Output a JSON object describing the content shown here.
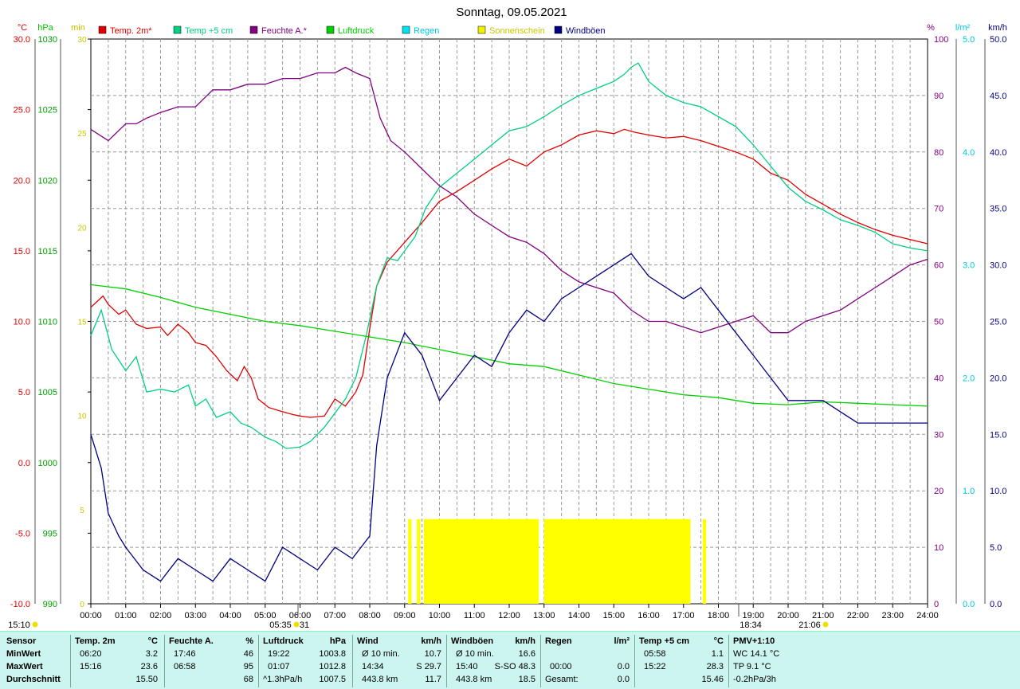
{
  "title": "Sonntag, 09.05.2021",
  "axes_left": {
    "temp_unit": "°C",
    "press_unit": "hPa",
    "min_unit": "min",
    "temp_ticks": [
      "30.0",
      "25.0",
      "20.0",
      "15.0",
      "10.0",
      "5.0",
      "0.0",
      "-5.0",
      "-10.0"
    ],
    "press_ticks": [
      "1030",
      "1025",
      "1020",
      "1015",
      "1010",
      "1005",
      "1000",
      "995",
      "990"
    ],
    "min_ticks": [
      "30",
      "25",
      "20",
      "15",
      "10",
      "5",
      "0"
    ]
  },
  "axes_right": {
    "pct_unit": "%",
    "rain_unit": "l/m²",
    "wind_unit": "km/h",
    "pct_ticks": [
      "100",
      "90",
      "80",
      "70",
      "60",
      "50",
      "40",
      "30",
      "20",
      "10",
      "0"
    ],
    "rain_ticks": [
      "5.0",
      "4.0",
      "3.0",
      "2.0",
      "1.0",
      "0.0"
    ],
    "wind_ticks": [
      "50.0",
      "45.0",
      "40.0",
      "35.0",
      "30.0",
      "25.0",
      "20.0",
      "15.0",
      "10.0",
      "5.0",
      "0.0"
    ]
  },
  "x_ticks": [
    "00:00",
    "01:00",
    "02:00",
    "03:00",
    "04:00",
    "05:00",
    "06:00",
    "07:00",
    "08:00",
    "09:00",
    "10:00",
    "11:00",
    "12:00",
    "13:00",
    "14:00",
    "15:00",
    "16:00",
    "17:00",
    "18:00",
    "19:00",
    "20:00",
    "21:00",
    "22:00",
    "23:00",
    "24:00"
  ],
  "markers": {
    "sunrise": "05:35",
    "sunrise_b": "31",
    "sunset": "18:34",
    "moonset": "21:06",
    "left_time": "15:10"
  },
  "legend": [
    {
      "label": "Temp. 2m*",
      "color": "#e00000"
    },
    {
      "label": "Temp +5 cm",
      "color": "#00d080"
    },
    {
      "label": "Feuchte A.*",
      "color": "#800080"
    },
    {
      "label": "Luftdruck",
      "color": "#00d000"
    },
    {
      "label": "Regen",
      "color": "#00e0f0"
    },
    {
      "label": "Sonnenschein",
      "color": "#f0f000"
    },
    {
      "label": "Windböen",
      "color": "#000080"
    }
  ],
  "chart_data": {
    "type": "line",
    "title": "Sonntag, 09.05.2021",
    "x_unit": "hour",
    "x_range": [
      0,
      24
    ],
    "series": [
      {
        "name": "Temp. 2m*",
        "axis": "°C",
        "range": [
          -10,
          30
        ],
        "color": "#e00000",
        "x": [
          0,
          0.35,
          0.5,
          0.8,
          1.0,
          1.3,
          1.6,
          2.0,
          2.2,
          2.5,
          2.8,
          3.0,
          3.3,
          3.6,
          3.9,
          4.2,
          4.4,
          4.6,
          4.8,
          5.1,
          5.5,
          5.8,
          6.0,
          6.3,
          6.7,
          7.0,
          7.3,
          7.6,
          7.8,
          8.0,
          8.2,
          8.5,
          9.0,
          9.5,
          10.0,
          10.5,
          11.0,
          11.5,
          12.0,
          12.5,
          13.0,
          13.5,
          14.0,
          14.5,
          15.0,
          15.3,
          15.6,
          16.0,
          16.5,
          17.0,
          17.5,
          18.0,
          18.5,
          19.0,
          19.5,
          20.0,
          20.5,
          21.0,
          21.5,
          22.0,
          22.5,
          23.0,
          23.5,
          24.0
        ],
        "y": [
          11.0,
          11.8,
          11.2,
          10.5,
          10.8,
          9.8,
          9.5,
          9.6,
          9.0,
          9.8,
          9.2,
          8.5,
          8.3,
          7.5,
          6.5,
          5.8,
          6.8,
          6.0,
          4.5,
          3.9,
          3.6,
          3.4,
          3.3,
          3.2,
          3.3,
          4.5,
          4.0,
          5.0,
          6.2,
          9.5,
          12.5,
          14.2,
          15.6,
          17.0,
          18.5,
          19.2,
          20.0,
          20.8,
          21.5,
          21.0,
          22.0,
          22.5,
          23.2,
          23.5,
          23.3,
          23.6,
          23.4,
          23.2,
          23.0,
          23.1,
          22.8,
          22.4,
          22.0,
          21.5,
          20.5,
          20.0,
          19.0,
          18.3,
          17.6,
          17.0,
          16.5,
          16.1,
          15.8,
          15.5
        ]
      },
      {
        "name": "Temp +5 cm",
        "axis": "°C",
        "range": [
          -10,
          30
        ],
        "color": "#00d080",
        "x": [
          0,
          0.3,
          0.6,
          1.0,
          1.3,
          1.6,
          2.0,
          2.4,
          2.8,
          3.0,
          3.3,
          3.6,
          4.0,
          4.3,
          4.6,
          5.0,
          5.3,
          5.6,
          6.0,
          6.3,
          6.7,
          7.0,
          7.3,
          7.6,
          7.9,
          8.2,
          8.5,
          8.8,
          9.0,
          9.3,
          9.6,
          10.0,
          10.5,
          11.0,
          11.5,
          12.0,
          12.5,
          13.0,
          13.5,
          14.0,
          14.5,
          15.0,
          15.3,
          15.5,
          15.7,
          16.0,
          16.5,
          17.0,
          17.5,
          18.0,
          18.5,
          19.0,
          19.5,
          20.0,
          20.5,
          21.0,
          21.5,
          22.0,
          22.5,
          23.0,
          23.5,
          24.0
        ],
        "y": [
          9.0,
          10.8,
          8.0,
          6.5,
          7.5,
          5.0,
          5.2,
          5.0,
          5.5,
          4.0,
          4.5,
          3.2,
          3.6,
          2.8,
          2.5,
          1.8,
          1.5,
          1.0,
          1.1,
          1.5,
          2.5,
          3.5,
          4.5,
          6.0,
          9.0,
          12.5,
          14.5,
          14.3,
          15.0,
          16.0,
          18.0,
          19.5,
          20.5,
          21.5,
          22.5,
          23.5,
          23.8,
          24.5,
          25.3,
          26.0,
          26.5,
          27.0,
          27.5,
          28.0,
          28.3,
          27.0,
          26.0,
          25.5,
          25.2,
          24.5,
          23.8,
          22.5,
          21.0,
          19.5,
          18.5,
          17.9,
          17.2,
          16.8,
          16.3,
          15.5,
          15.2,
          15.0
        ]
      },
      {
        "name": "Feuchte A.*",
        "axis": "%",
        "range": [
          0,
          100
        ],
        "color": "#800080",
        "x": [
          0,
          0.5,
          1.0,
          1.3,
          1.6,
          2.0,
          2.5,
          3.0,
          3.5,
          4.0,
          4.5,
          5.0,
          5.5,
          6.0,
          6.5,
          7.0,
          7.3,
          7.6,
          8.0,
          8.3,
          8.6,
          9.0,
          9.5,
          10.0,
          10.5,
          11.0,
          11.5,
          12.0,
          12.5,
          13.0,
          13.5,
          14.0,
          14.5,
          15.0,
          15.5,
          16.0,
          16.5,
          17.0,
          17.5,
          18.0,
          18.5,
          19.0,
          19.5,
          20.0,
          20.5,
          21.0,
          21.5,
          22.0,
          22.5,
          23.0,
          23.5,
          24.0
        ],
        "y": [
          84,
          82,
          85,
          85,
          86,
          87,
          88,
          88,
          91,
          91,
          92,
          92,
          93,
          93,
          94,
          94,
          95,
          94,
          93,
          86,
          82,
          80,
          77,
          74,
          72,
          69,
          67,
          65,
          64,
          62,
          59,
          57,
          56,
          55,
          52,
          50,
          50,
          49,
          48,
          49,
          50,
          51,
          48,
          48,
          50,
          51,
          52,
          54,
          56,
          58,
          60,
          61
        ]
      },
      {
        "name": "Luftdruck",
        "axis": "hPa",
        "range": [
          990,
          1030
        ],
        "color": "#00d000",
        "x": [
          0,
          1,
          2,
          3,
          4,
          5,
          6,
          7,
          8,
          9,
          10,
          11,
          12,
          13,
          14,
          15,
          16,
          17,
          18,
          19,
          20,
          21,
          22,
          23,
          24
        ],
        "y": [
          1012.6,
          1012.3,
          1011.7,
          1011.0,
          1010.5,
          1010.0,
          1009.7,
          1009.3,
          1008.9,
          1008.5,
          1008.0,
          1007.5,
          1007.0,
          1006.8,
          1006.2,
          1005.6,
          1005.2,
          1004.8,
          1004.6,
          1004.2,
          1004.1,
          1004.3,
          1004.2,
          1004.1,
          1004.0
        ]
      },
      {
        "name": "Windböen",
        "axis": "km/h",
        "range": [
          0,
          50
        ],
        "color": "#000080",
        "x": [
          0,
          0.3,
          0.5,
          0.8,
          1.0,
          1.5,
          2.0,
          2.5,
          3.0,
          3.5,
          4.0,
          4.5,
          5.0,
          5.5,
          6.0,
          6.5,
          7.0,
          7.5,
          8.0,
          8.2,
          8.5,
          9.0,
          9.5,
          10.0,
          10.5,
          11.0,
          11.5,
          12.0,
          12.5,
          13.0,
          13.5,
          14.0,
          14.5,
          15.0,
          15.5,
          16.0,
          16.5,
          17.0,
          17.5,
          18.0,
          18.5,
          19.0,
          19.5,
          20.0,
          20.5,
          21.0,
          21.5,
          22.0,
          22.5,
          23.0,
          23.5,
          24.0
        ],
        "y": [
          15,
          12,
          8,
          6,
          5,
          3,
          2,
          4,
          3,
          2,
          4,
          3,
          2,
          5,
          4,
          3,
          5,
          4,
          6,
          14,
          20,
          24,
          22,
          18,
          20,
          22,
          21,
          24,
          26,
          25,
          27,
          28,
          29,
          30,
          31,
          29,
          28,
          27,
          28,
          26,
          24,
          22,
          20,
          18,
          18,
          18,
          17,
          16,
          16,
          16,
          16,
          16
        ]
      }
    ],
    "sunshine_min": {
      "axis": "min",
      "intervals": [
        [
          9.1,
          9.2
        ],
        [
          9.35,
          9.45
        ],
        [
          9.55,
          12.85
        ],
        [
          13.0,
          17.2
        ],
        [
          17.55,
          17.65
        ]
      ],
      "value": 4.5
    },
    "grid": true
  },
  "stats": {
    "sensor": {
      "h": "Sensor",
      "r1": "MinWert",
      "r2": "MaxWert",
      "r3": "Durchschnitt"
    },
    "temp2m": {
      "h": "Temp. 2m",
      "u": "°C",
      "t1": "06:20",
      "v1": "3.2",
      "t2": "15:16",
      "v2": "23.6",
      "v3": "15.50"
    },
    "feuchte": {
      "h": "Feuchte A.",
      "u": "%",
      "t1": "17:46",
      "v1": "46",
      "t2": "06:58",
      "v2": "95",
      "v3": "68"
    },
    "luftdruck": {
      "h": "Luftdruck",
      "u": "hPa",
      "t1": "19:22",
      "v1": "1003.8",
      "t2": "01:07",
      "v2": "1012.8",
      "t3": "^1.3hPa/h",
      "v3": "1007.5"
    },
    "wind": {
      "h": "Wind",
      "u": "km/h",
      "t1": "Ø 10 min.",
      "v1": "10.7",
      "t2": "14:34",
      "v2": "S 29.7",
      "t3": "443.8 km",
      "v3": "11.7"
    },
    "windboen": {
      "h": "Windböen",
      "u": "km/h",
      "t1": "Ø 10 min.",
      "v1": "16.6",
      "t2": "15:40",
      "v2": "S-SO 48.3",
      "t3": "443.8 km",
      "v3": "18.5"
    },
    "regen": {
      "h": "Regen",
      "u": "l/m²",
      "t2": "00:00",
      "v2": "0.0",
      "t3": "Gesamt:",
      "v3": "0.0"
    },
    "temp5": {
      "h": "Temp +5 cm",
      "u": "°C",
      "t1": "05:58",
      "v1": "1.1",
      "t2": "15:22",
      "v2": "28.3",
      "v3": "15.46"
    },
    "pmv": {
      "h": "PMV+1:10",
      "l1": "WC 14.1 °C",
      "l2": "TP 9.1 °C",
      "l3": "-0.2hPa/3h"
    }
  }
}
